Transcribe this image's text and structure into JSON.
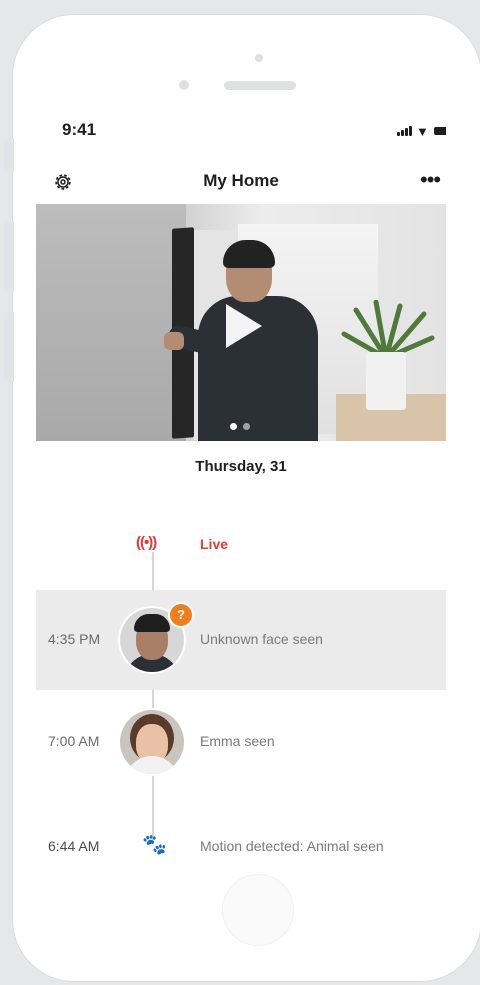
{
  "status_bar": {
    "time": "9:41"
  },
  "header": {
    "title": "My Home",
    "more": "•••"
  },
  "video": {
    "slides": 2,
    "active_slide": 1
  },
  "date_label": "Thursday, 31",
  "timeline": {
    "live": {
      "icon": "live-broadcast-icon",
      "glyph": "((•))",
      "label": "Live",
      "color": "#e53935"
    },
    "events": [
      {
        "time": "4:35 PM",
        "label": "Unknown face seen",
        "avatar": "unknown-person",
        "badge": "?",
        "highlighted": true
      },
      {
        "time": "7:00 AM",
        "label": "Emma seen",
        "avatar": "emma"
      },
      {
        "time": "6:44 AM",
        "label": "Motion detected: Animal seen",
        "icon": "paw-icon"
      }
    ]
  },
  "colors": {
    "accent_orange": "#f07d1f",
    "paw": "#f5a623",
    "live_red": "#e53935"
  }
}
